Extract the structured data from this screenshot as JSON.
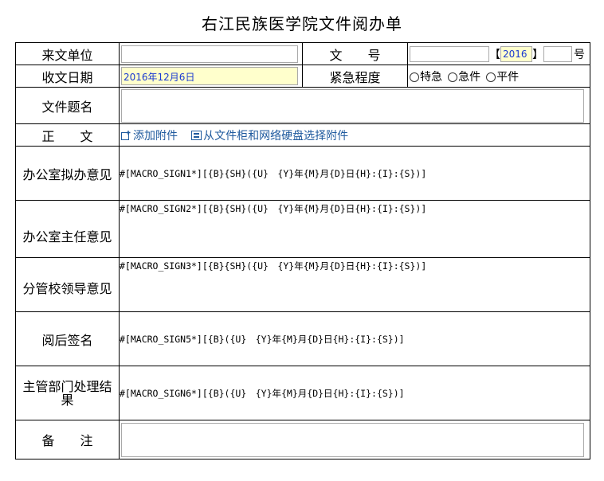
{
  "title": "右江民族医学院文件阅办单",
  "rows": {
    "source_unit": {
      "label": "来文单位",
      "value": ""
    },
    "doc_number": {
      "label": "文　　号",
      "bracket_open": "【",
      "year": "2016",
      "bracket_close": "】",
      "suffix": "号"
    },
    "receive_date": {
      "label": "收文日期",
      "value": "2016年12月6日"
    },
    "urgency": {
      "label": "紧急程度",
      "options": [
        "特急",
        "急件",
        "平件"
      ]
    },
    "doc_title": {
      "label": "文件题名",
      "value": ""
    },
    "body": {
      "label": "正　　文",
      "add_attachment": "添加附件",
      "select_attachment": "从文件柜和网络硬盘选择附件"
    },
    "office_draft": {
      "label": "办公室拟办意见",
      "macro": "#[MACRO_SIGN1*][{B}{SH}({U}　{Y}年{M}月{D}日{H}:{I}:{S})]"
    },
    "office_director": {
      "label": "办公室主任意见",
      "macro": "#[MACRO_SIGN2*][{B}{SH}({U}　{Y}年{M}月{D}日{H}:{I}:{S})]"
    },
    "school_leader": {
      "label": "分管校领导意见",
      "macro": "#[MACRO_SIGN3*][{B}{SH}({U}　{Y}年{M}月{D}日{H}:{I}:{S})]"
    },
    "read_sign": {
      "label": "阅后签名",
      "macro": "#[MACRO_SIGN5*][{B}({U}　{Y}年{M}月{D}日{H}:{I}:{S})]"
    },
    "dept_result": {
      "label": "主管部门处理结果",
      "macro": "#[MACRO_SIGN6*][{B}({U}　{Y}年{M}月{D}日{H}:{I}:{S})]"
    },
    "remarks": {
      "label": "备　　注",
      "value": ""
    }
  },
  "colors": {
    "accent_link": "#1f5a9e",
    "date_text": "#1a3ad1",
    "date_bg": "#ffffcc"
  }
}
